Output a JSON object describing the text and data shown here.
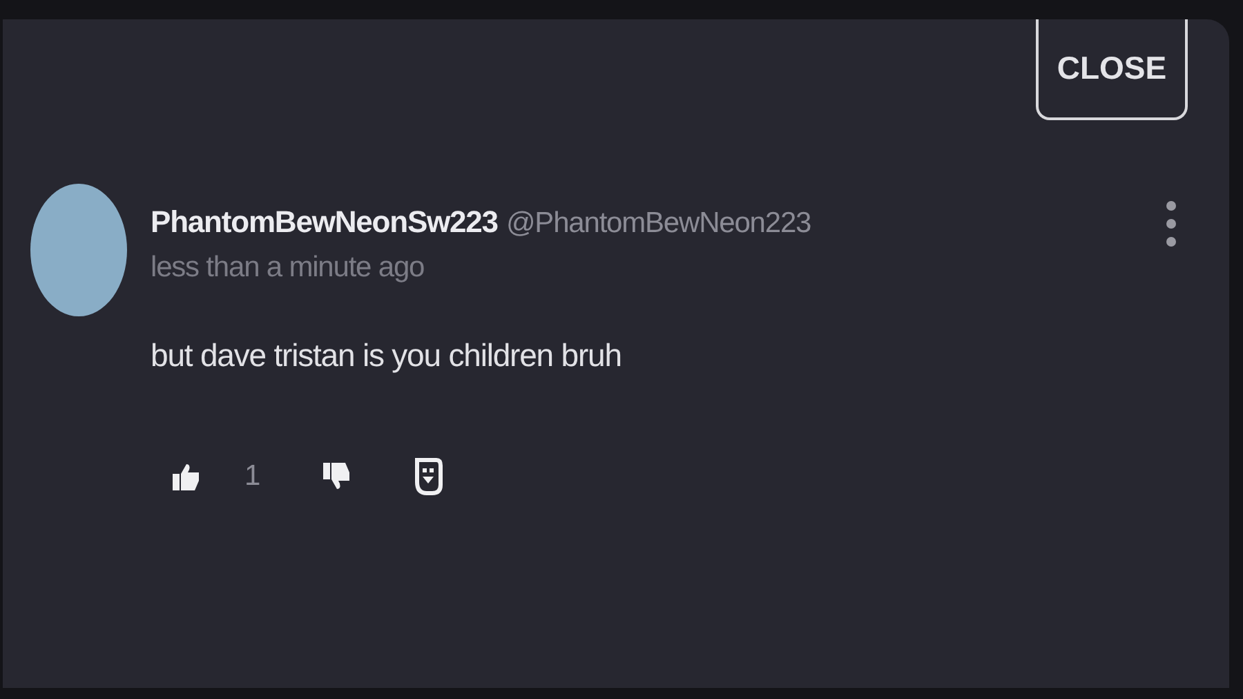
{
  "close_button": {
    "label": "CLOSE"
  },
  "comment": {
    "author": "PhantomBewNeonSw223",
    "handle": "@PhantomBewNeon223",
    "time": "less than a minute ago",
    "text": "but dave tristan is you children bruh",
    "actions": {
      "like_count": "1"
    }
  }
}
